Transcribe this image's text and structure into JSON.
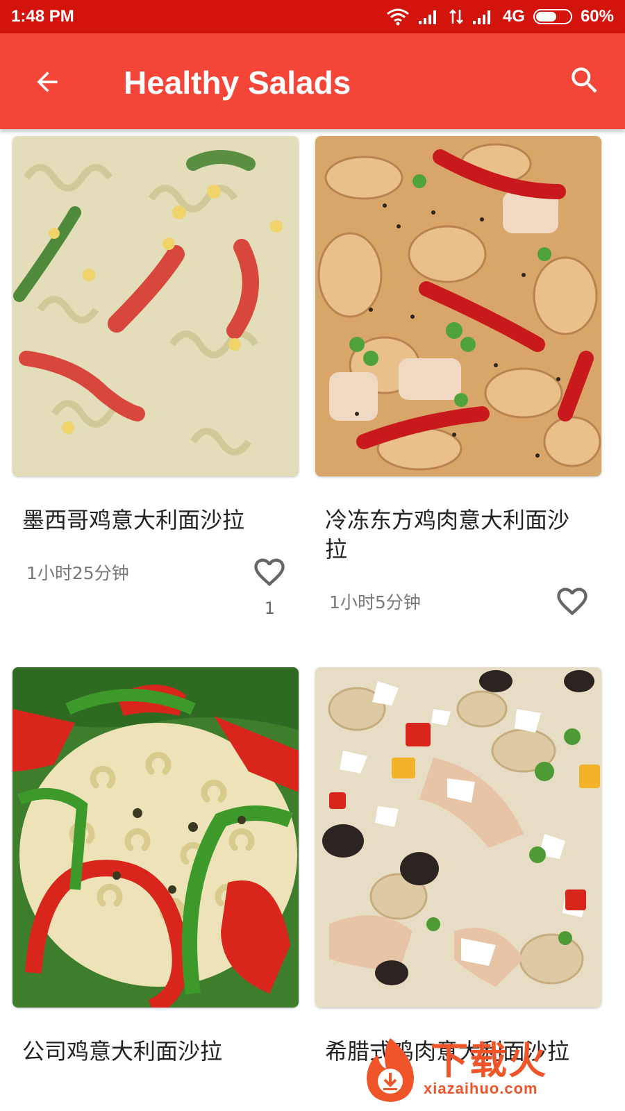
{
  "status_bar": {
    "time": "1:48 PM",
    "network_type": "4G",
    "battery_percent": "60%",
    "battery_level": 0.6
  },
  "app_bar": {
    "title": "Healthy Salads",
    "back_icon": "arrow-left-icon",
    "search_icon": "search-icon",
    "color": "#f34639"
  },
  "recipes": [
    {
      "title": "墨西哥鸡意大利面沙拉",
      "time": "1小时25分钟",
      "likes": "1",
      "liked": false
    },
    {
      "title": "冷冻东方鸡肉意大利面沙拉",
      "time": "1小时5分钟",
      "likes": "",
      "liked": false
    },
    {
      "title": "公司鸡意大利面沙拉",
      "time": "",
      "likes": "",
      "liked": false
    },
    {
      "title": "希腊式鸡肉意大利面沙拉",
      "time": "",
      "likes": "",
      "liked": false
    }
  ],
  "watermark": {
    "text": "下载火",
    "url": "xiazaihuo.com"
  }
}
